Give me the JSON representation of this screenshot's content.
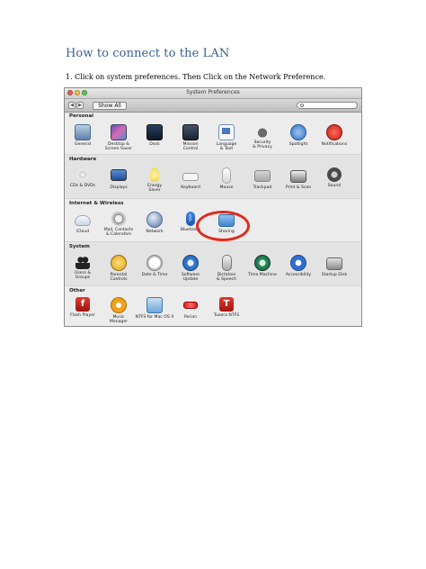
{
  "doc": {
    "title": "How to connect to the LAN",
    "step1": "1. Click on system preferences. Then Click on the Network Preference."
  },
  "window": {
    "title": "System Preferences",
    "show_all": "Show All"
  },
  "sections": {
    "personal": {
      "label": "Personal",
      "items": [
        "General",
        "Desktop &\nScreen Saver",
        "Dock",
        "Mission\nControl",
        "Language\n& Text",
        "Security\n& Privacy",
        "Spotlight",
        "Notifications"
      ]
    },
    "hardware": {
      "label": "Hardware",
      "items": [
        "CDs & DVDs",
        "Displays",
        "Energy\nSaver",
        "Keyboard",
        "Mouse",
        "Trackpad",
        "Print & Scan",
        "Sound"
      ]
    },
    "internet": {
      "label": "Internet & Wireless",
      "items": [
        "iCloud",
        "Mail, Contacts\n& Calendars",
        "Network",
        "Bluetooth",
        "Sharing"
      ]
    },
    "system": {
      "label": "System",
      "items": [
        "Users &\nGroups",
        "Parental\nControls",
        "Date & Time",
        "Software\nUpdate",
        "Dictation\n& Speech",
        "Time Machine",
        "Accessibility",
        "Startup Disk"
      ]
    },
    "other": {
      "label": "Other",
      "items": [
        "Flash Player",
        "Music\nManager",
        "NTFS for Mac OS X",
        "Perian",
        "Tuxera NTFS"
      ]
    }
  },
  "colors": {
    "title": "#365f91",
    "highlight_ring": "#e02b20"
  }
}
